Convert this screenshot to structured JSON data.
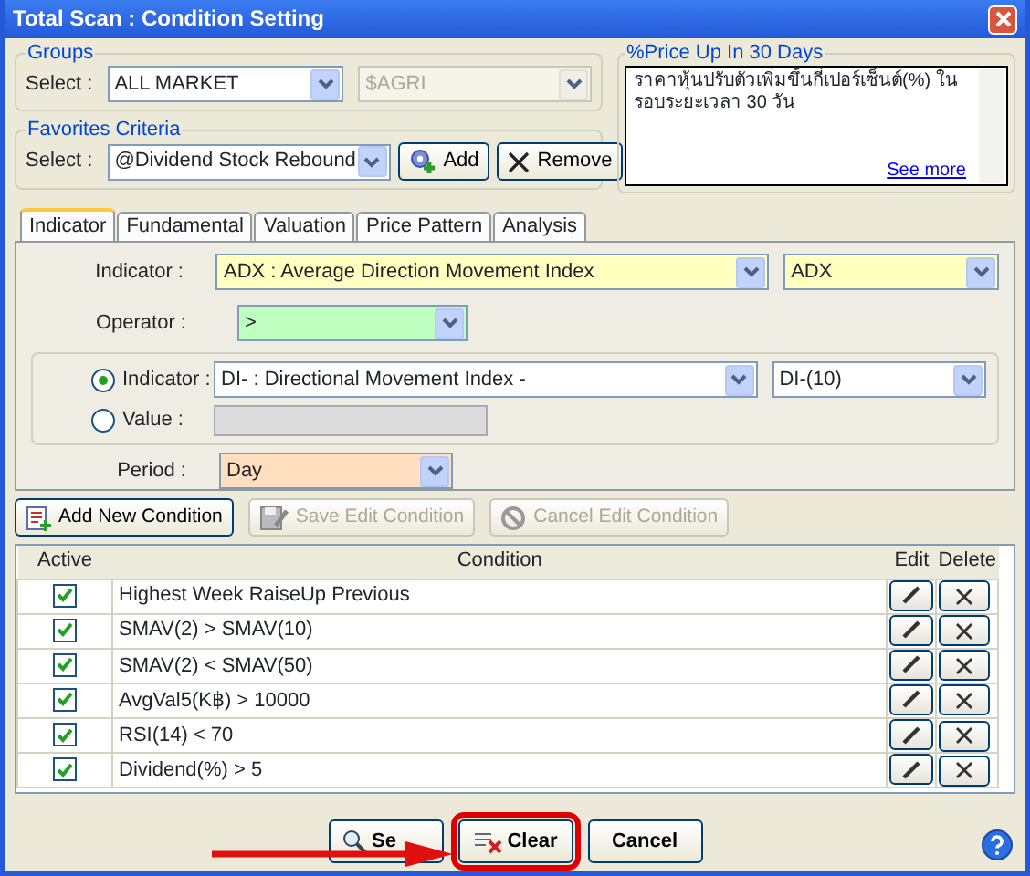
{
  "window": {
    "title": "Total Scan : Condition Setting"
  },
  "groups": {
    "legend": "Groups",
    "select_label": "Select :",
    "market": {
      "value": "ALL MARKET",
      "disabled": false
    },
    "sector": {
      "value": "$AGRI",
      "disabled": true
    }
  },
  "favorites": {
    "legend": "Favorites Criteria",
    "select_label": "Select :",
    "value": "@Dividend Stock Rebound",
    "buttons": [
      {
        "kind": "add",
        "label": "Add"
      },
      {
        "kind": "remove",
        "label": "Remove"
      }
    ]
  },
  "description": {
    "legend": "%Price Up In 30 Days",
    "text": "ราคาหุ้นปรับตัวเพิ่มขึ้นกี่เปอร์เซ็นต์(%) ในรอบระยะเวลา 30 วัน",
    "link": "See more"
  },
  "tabs": [
    {
      "label": "Indicator",
      "selected": true
    },
    {
      "label": "Fundamental",
      "selected": false
    },
    {
      "label": "Valuation",
      "selected": false
    },
    {
      "label": "Price Pattern",
      "selected": false
    },
    {
      "label": "Analysis",
      "selected": false
    }
  ],
  "form": {
    "indicator": {
      "label": "Indicator :",
      "value": "ADX : Average Direction Movement Index",
      "param": "ADX"
    },
    "operator": {
      "label": "Operator :",
      "value": ">"
    },
    "compare": [
      {
        "kind": "indicator",
        "label": "Indicator :",
        "selected": true,
        "value": "DI- : Directional Movement Index -",
        "param": "DI-(10)"
      },
      {
        "kind": "value",
        "label": "Value :",
        "selected": false
      }
    ],
    "period": {
      "label": "Period :",
      "value": "Day"
    }
  },
  "condition_buttons": [
    {
      "kind": "add",
      "label": "Add New Condition",
      "disabled": false
    },
    {
      "kind": "save",
      "label": "Save Edit Condition",
      "disabled": true
    },
    {
      "kind": "cancel",
      "label": "Cancel Edit Condition",
      "disabled": true
    }
  ],
  "table": {
    "columns": [
      "Active",
      "Condition",
      "Edit",
      "Delete"
    ],
    "rows": [
      {
        "active": true,
        "condition": "Highest Week RaiseUp Previous"
      },
      {
        "active": true,
        "condition": "SMAV(2) > SMAV(10)"
      },
      {
        "active": true,
        "condition": "SMAV(2) < SMAV(50)"
      },
      {
        "active": true,
        "condition": "AvgVal5(K฿) > 10000"
      },
      {
        "active": true,
        "condition": "RSI(14) < 70"
      },
      {
        "active": true,
        "condition": "Dividend(%) > 5"
      }
    ]
  },
  "footer": {
    "buttons": [
      {
        "kind": "search",
        "label": "Se",
        "highlighted": false
      },
      {
        "kind": "clear",
        "label": "Clear",
        "highlighted": true
      },
      {
        "kind": "cancel",
        "label": "Cancel",
        "highlighted": false
      }
    ]
  }
}
